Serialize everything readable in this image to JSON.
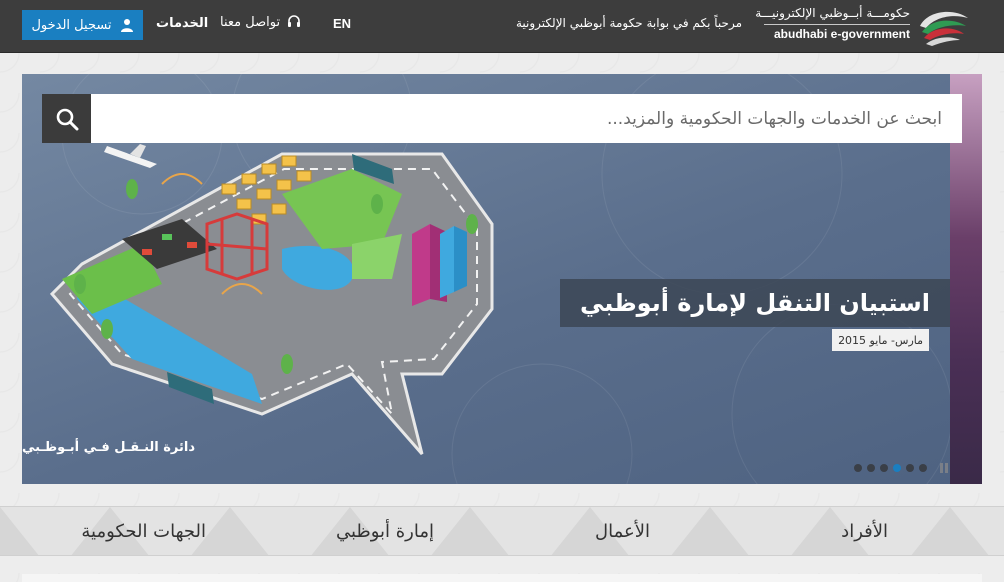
{
  "header": {
    "login_label": "تسجيل الدخول",
    "services_label": "الخدمات",
    "contact_label": "تواصل معنا",
    "lang_label": "EN",
    "welcome_text": "مرحباً بكم في بوابة حكومة أبوظبي الإلكترونية",
    "logo_ar": "حكومـــة أبــوظبي الإلكترونيـــة",
    "logo_en": "abudhabi e-government"
  },
  "search": {
    "placeholder": "ابحث عن الخدمات والجهات الحكومية والمزيد..."
  },
  "hero": {
    "title": "استبيان التنقل لإمارة أبوظبي",
    "date": "مارس- مايو 2015",
    "image_credit": "دائرة النـقـل فـي أبـوظـبي",
    "slides_count": 6,
    "active_slide": 4
  },
  "bottom_nav": {
    "items": [
      "الأفراد",
      "الأعمال",
      "إمارة أبوظبي",
      "الجهات الحكومية"
    ]
  },
  "colors": {
    "accent": "#1a7fc1",
    "topbar": "#3d3d3d",
    "hero_bg": "#5a6e8c"
  }
}
